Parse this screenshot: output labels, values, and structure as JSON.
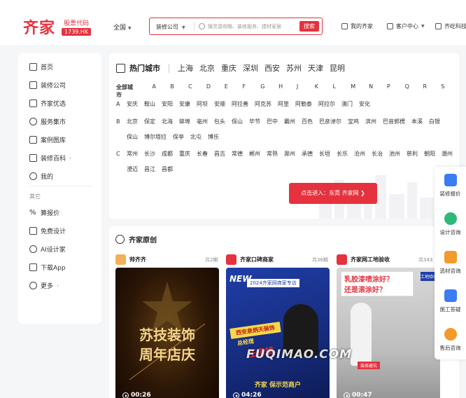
{
  "header": {
    "logo": "齐家",
    "stock_label": "股票代码",
    "stock_code": "1739.HK",
    "region": "全国",
    "search_category": "装修公司",
    "search_placeholder": "搜灵感攻略、装修服务、建材家居",
    "search_button": "搜索",
    "nav": [
      "我的齐家",
      "客户中心",
      "齐屹科技"
    ]
  },
  "sidebar": {
    "items": [
      {
        "label": "首页",
        "icon": "home-icon"
      },
      {
        "label": "装修公司",
        "icon": "building-icon"
      },
      {
        "label": "齐家优选",
        "icon": "shop-icon"
      },
      {
        "label": "服务集市",
        "icon": "planet-icon"
      },
      {
        "label": "案例图库",
        "icon": "gallery-icon"
      },
      {
        "label": "装修百科",
        "icon": "book-icon",
        "chevron": "›"
      },
      {
        "label": "我的",
        "icon": "user-icon"
      }
    ],
    "group_label": "其它",
    "other_items": [
      {
        "label": "算报价",
        "icon": "percent-icon"
      },
      {
        "label": "免费设计",
        "icon": "design-icon"
      },
      {
        "label": "AI设计家",
        "icon": "ai-icon"
      },
      {
        "label": "下载App",
        "icon": "download-icon"
      },
      {
        "label": "更多",
        "icon": "more-icon",
        "chevron": "›"
      }
    ]
  },
  "hot_cities": {
    "title": "热门城市",
    "top_cities": [
      "上海",
      "北京",
      "重庆",
      "深圳",
      "西安",
      "苏州",
      "天津",
      "昆明"
    ],
    "all_label": "全部城市",
    "letters": [
      "A",
      "B",
      "C",
      "D",
      "E",
      "F",
      "G",
      "H",
      "J",
      "K",
      "L",
      "M",
      "N",
      "P",
      "Q",
      "R",
      "S"
    ],
    "rows": [
      {
        "key": "A",
        "names": [
          "安庆",
          "鞍山",
          "安阳",
          "安康",
          "阿坝",
          "安顺",
          "阿拉善",
          "阿克苏",
          "阿里",
          "阿勒泰",
          "阿拉尔",
          "澳门",
          "安化"
        ]
      },
      {
        "key": "B",
        "names": [
          "北京",
          "保定",
          "北海",
          "蚌埠",
          "亳州",
          "包头",
          "保山",
          "毕节",
          "巴中",
          "霸州",
          "百色",
          "巴彦淖尔",
          "宝鸡",
          "滨州",
          "巴音郭楞",
          "本溪",
          "白银",
          "保山",
          "博尔塔拉",
          "保亭",
          "北屯",
          "博乐"
        ]
      },
      {
        "key": "C",
        "names": [
          "常州",
          "长沙",
          "成都",
          "重庆",
          "长春",
          "昌吉",
          "常德",
          "郴州",
          "常熟",
          "滁州",
          "承德",
          "长垣",
          "长乐",
          "沧州",
          "长治",
          "池州",
          "慈利",
          "朝阳",
          "潮州",
          "澄迈",
          "昌江",
          "昌都"
        ]
      }
    ],
    "cta": "点击进入：东莞 齐家网 ❯"
  },
  "original": {
    "title": "齐家原创",
    "cards": [
      {
        "name": "帅齐齐",
        "count": "共2期",
        "thumb_text": [
          "苏技装饰",
          "周年店庆"
        ],
        "duration": "00:26"
      },
      {
        "name": "齐家口碑商家",
        "count": "共36期",
        "thumb_text": [
          "NEW",
          "2024齐家网商家专访",
          "西安泉炳天装饰",
          "总经理",
          "王泽斌",
          "齐家 保示范商户"
        ],
        "duration": "04:26"
      },
      {
        "name": "齐家网工地验收",
        "count": "共343",
        "thumb_text": [
          "乳胶漆喷涂好？",
          "还是滚涂好？",
          "工地验收",
          "装修避坑"
        ],
        "duration": "00:47"
      }
    ]
  },
  "float_panel": {
    "items": [
      {
        "label": "装修报价",
        "icon": "quote-icon",
        "color": "#3b7cf0"
      },
      {
        "label": "设计咨询",
        "icon": "design-consult-icon",
        "color": "#2fb87a"
      },
      {
        "label": "选材咨询",
        "icon": "material-icon",
        "color": "#f39a2c"
      },
      {
        "label": "施工答疑",
        "icon": "build-icon",
        "color": "#3b7cf0"
      },
      {
        "label": "售后咨询",
        "icon": "aftersale-icon",
        "color": "#f39a2c"
      }
    ]
  },
  "watermark": "FUQIMAO.COM",
  "colors": {
    "brand": "#e5323e"
  }
}
